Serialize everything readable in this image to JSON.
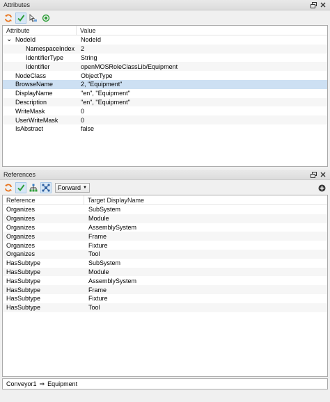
{
  "attributes": {
    "title": "Attributes",
    "columns": {
      "attribute": "Attribute",
      "value": "Value"
    },
    "rows": [
      {
        "name": "NodeId",
        "value": "NodeId",
        "level": 0,
        "expander": true
      },
      {
        "name": "NamespaceIndex",
        "value": "2",
        "level": 2
      },
      {
        "name": "IdentifierType",
        "value": "String",
        "level": 2
      },
      {
        "name": "Identifier",
        "value": "openMOSRoleClassLib/Equipment",
        "level": 2
      },
      {
        "name": "NodeClass",
        "value": "ObjectType",
        "level": 1
      },
      {
        "name": "BrowseName",
        "value": "2, \"Equipment\"",
        "level": 1,
        "selected": true
      },
      {
        "name": "DisplayName",
        "value": "\"en\", \"Equipment\"",
        "level": 1
      },
      {
        "name": "Description",
        "value": "\"en\", \"Equipment\"",
        "level": 1
      },
      {
        "name": "WriteMask",
        "value": "0",
        "level": 1
      },
      {
        "name": "UserWriteMask",
        "value": "0",
        "level": 1
      },
      {
        "name": "IsAbstract",
        "value": "false",
        "level": 1
      }
    ]
  },
  "references": {
    "title": "References",
    "direction": "Forward",
    "columns": {
      "reference": "Reference",
      "target": "Target DisplayName"
    },
    "rows": [
      {
        "reference": "Organizes",
        "target": "SubSystem"
      },
      {
        "reference": "Organizes",
        "target": "Module"
      },
      {
        "reference": "Organizes",
        "target": "AssemblySystem"
      },
      {
        "reference": "Organizes",
        "target": "Frame"
      },
      {
        "reference": "Organizes",
        "target": "Fixture"
      },
      {
        "reference": "Organizes",
        "target": "Tool"
      },
      {
        "reference": "HasSubtype",
        "target": "SubSystem"
      },
      {
        "reference": "HasSubtype",
        "target": "Module"
      },
      {
        "reference": "HasSubtype",
        "target": "AssemblySystem"
      },
      {
        "reference": "HasSubtype",
        "target": "Frame"
      },
      {
        "reference": "HasSubtype",
        "target": "Fixture"
      },
      {
        "reference": "HasSubtype",
        "target": "Tool"
      }
    ]
  },
  "statusbar": {
    "from": "Conveyor1",
    "arrow": "⇒",
    "to": "Equipment"
  },
  "colors": {
    "selected_row": "#cde0f3",
    "refresh_icon": "#e8731c",
    "check_icon": "#2f9e3a"
  }
}
